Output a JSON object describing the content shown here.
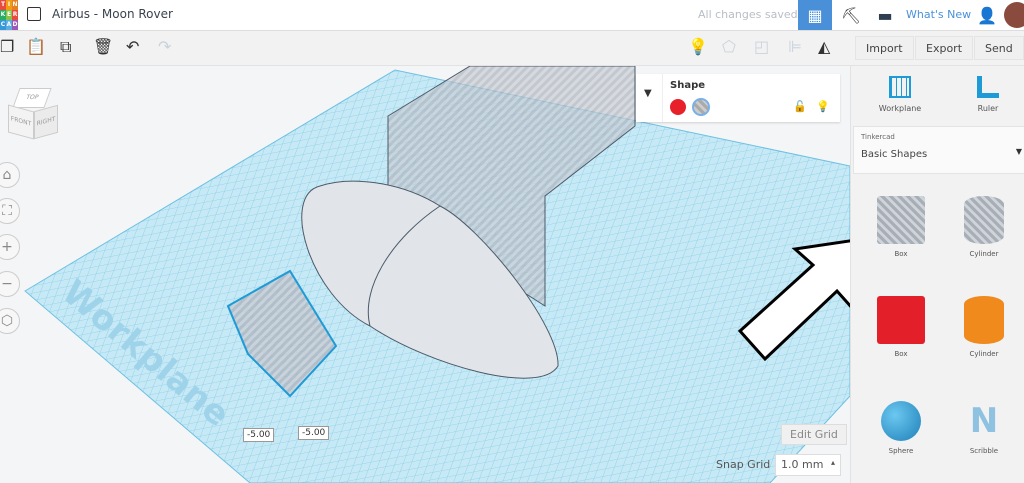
{
  "header": {
    "logo_letters": [
      "T",
      "I",
      "N",
      "K",
      "E",
      "R",
      "C",
      "A",
      "D"
    ],
    "title": "Airbus - Moon Rover",
    "save_status": "All changes saved",
    "whats_new": "What's New"
  },
  "toolbar": {
    "import": "Import",
    "export": "Export",
    "send_to": "Send To"
  },
  "shape_panel": {
    "title": "Shape",
    "solid_color": "#e8202a",
    "hole_label": "hole"
  },
  "view_cube": {
    "top": "TOP",
    "front": "FRONT",
    "right": "RIGHT"
  },
  "workplane_label": "Workplane",
  "dimensions": [
    "-5.00",
    "-5.00"
  ],
  "grid": {
    "edit_grid": "Edit Grid",
    "snap_label": "Snap Grid",
    "snap_value": "1.0 mm"
  },
  "right_panel": {
    "workplane": "Workplane",
    "ruler": "Ruler",
    "library_group": "Tinkercad",
    "library": "Basic Shapes",
    "shapes": [
      {
        "name": "Box",
        "color": "#b0b6bd"
      },
      {
        "name": "Cylinder",
        "color": "#b0b6bd"
      },
      {
        "name": "Box",
        "color": "#e3202a"
      },
      {
        "name": "Cylinder",
        "color": "#f08a1c"
      },
      {
        "name": "Sphere",
        "color": "#1e9bd7"
      },
      {
        "name": "Scribble",
        "color": "#8fc1e0"
      }
    ]
  },
  "colors": {
    "accent": "#4a90d9",
    "grid": "#7ecbe8"
  }
}
